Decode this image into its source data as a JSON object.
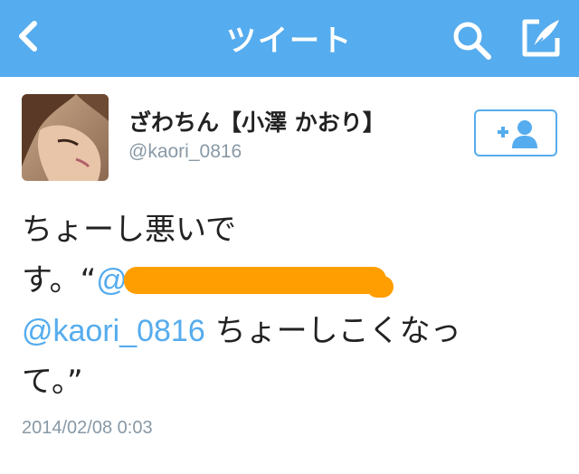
{
  "nav": {
    "title": "ツイート",
    "back_icon": "chevron-left-icon",
    "search_icon": "search-icon",
    "compose_icon": "compose-icon",
    "bar_color": "#55acee"
  },
  "tweet": {
    "author": {
      "display_name": "ざわちん【小澤 かおり】",
      "handle": "@kaori_0816",
      "follow_icon": "add-user-icon"
    },
    "text": {
      "line1": "ちょーし悪いで",
      "line2_prefix": "す。“",
      "line2_mention_partial": "@",
      "line3_mention": "@kaori_0816",
      "line3_rest": " ちょーしこくなっ",
      "line4": "て。”"
    },
    "timestamp": "2014/02/08 0:03",
    "redaction_color": "#ff9e00"
  }
}
